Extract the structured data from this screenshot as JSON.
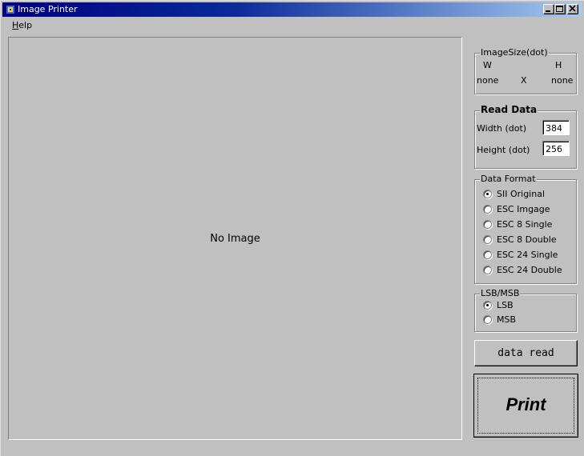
{
  "window": {
    "title": "Image Printer",
    "controls": [
      "minimize",
      "maximize",
      "close"
    ]
  },
  "menu": {
    "items": [
      {
        "label": "Help",
        "accel": "H",
        "rest": "elp"
      }
    ]
  },
  "canvas": {
    "placeholder": "No Image"
  },
  "image_size": {
    "legend": "ImageSize(dot)",
    "w_label": "W",
    "h_label": "H",
    "w_value": "none",
    "x_sep": "X",
    "h_value": "none"
  },
  "read_data": {
    "legend": "Read Data",
    "width_label": "Width (dot)",
    "width_value": "384",
    "height_label": "Height (dot)",
    "height_value": "256"
  },
  "data_format": {
    "legend": "Data Format",
    "options": [
      {
        "label": "SII Original",
        "checked": true
      },
      {
        "label": "ESC Imgage",
        "checked": false
      },
      {
        "label": "ESC 8 Single",
        "checked": false
      },
      {
        "label": "ESC 8 Double",
        "checked": false
      },
      {
        "label": "ESC 24 Single",
        "checked": false
      },
      {
        "label": "ESC 24 Double",
        "checked": false
      }
    ]
  },
  "bit_order": {
    "legend": "LSB/MSB",
    "options": [
      {
        "label": "LSB",
        "checked": true
      },
      {
        "label": "MSB",
        "checked": false
      }
    ]
  },
  "buttons": {
    "data_read": "data read",
    "print": "Print"
  },
  "colors": {
    "titlebar_start": "#000080",
    "titlebar_end": "#a6caf0",
    "face": "#c0c0c0"
  }
}
